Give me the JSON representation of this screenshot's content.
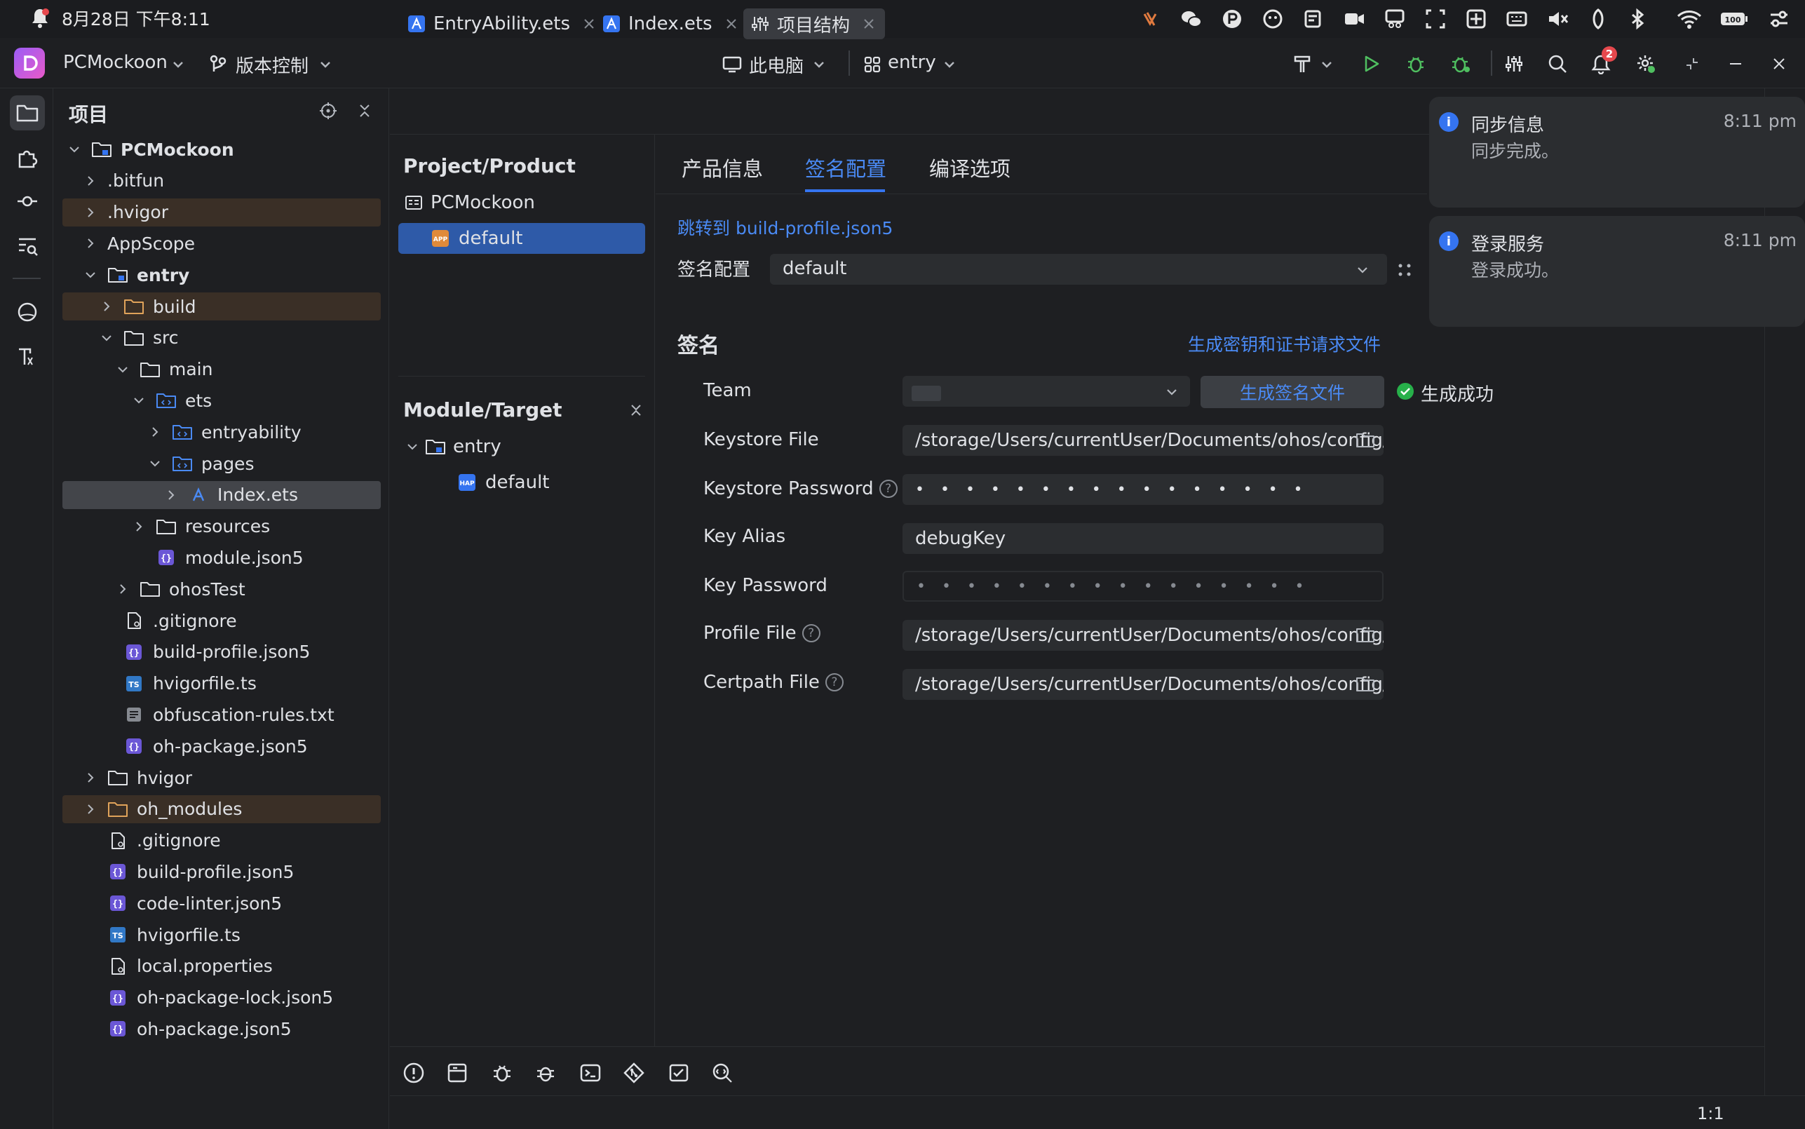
{
  "system_bar": {
    "datetime": "8月28日 下午8:11"
  },
  "title_bar": {
    "project_name": "PCMockoon",
    "vcs_label": "版本控制",
    "device_label": "此电脑",
    "module_label": "entry",
    "notification_count": "2"
  },
  "project_panel": {
    "title": "项目",
    "tree": [
      {
        "label": "PCMockoon",
        "depth": 0,
        "expanded": true,
        "icon": "project-folder",
        "bold": true
      },
      {
        "label": ".bitfun",
        "depth": 1,
        "icon": "none"
      },
      {
        "label": ".hvigor",
        "depth": 1,
        "icon": "none",
        "highlight": true
      },
      {
        "label": "AppScope",
        "depth": 1,
        "icon": "none"
      },
      {
        "label": "entry",
        "depth": 1,
        "expanded": true,
        "icon": "module-folder",
        "bold": true
      },
      {
        "label": "build",
        "depth": 2,
        "icon": "orange-folder",
        "highlight": true
      },
      {
        "label": "src",
        "depth": 2,
        "expanded": true,
        "icon": "folder"
      },
      {
        "label": "main",
        "depth": 3,
        "expanded": true,
        "icon": "folder"
      },
      {
        "label": "ets",
        "depth": 4,
        "expanded": true,
        "icon": "source-folder"
      },
      {
        "label": "entryability",
        "depth": 5,
        "icon": "source-folder"
      },
      {
        "label": "pages",
        "depth": 5,
        "expanded": true,
        "icon": "source-folder"
      },
      {
        "label": "Index.ets",
        "depth": 6,
        "icon": "ets-file",
        "selected": true
      },
      {
        "label": "resources",
        "depth": 4,
        "icon": "folder"
      },
      {
        "label": "module.json5",
        "depth": 4,
        "icon": "json-file",
        "leaf": true
      },
      {
        "label": "ohosTest",
        "depth": 3,
        "icon": "folder"
      },
      {
        "label": ".gitignore",
        "depth": 2,
        "icon": "text-file",
        "leaf": true
      },
      {
        "label": "build-profile.json5",
        "depth": 2,
        "icon": "json-file",
        "leaf": true
      },
      {
        "label": "hvigorfile.ts",
        "depth": 2,
        "icon": "ts-file",
        "leaf": true
      },
      {
        "label": "obfuscation-rules.txt",
        "depth": 2,
        "icon": "lines-file",
        "leaf": true
      },
      {
        "label": "oh-package.json5",
        "depth": 2,
        "icon": "json-file",
        "leaf": true
      },
      {
        "label": "hvigor",
        "depth": 1,
        "icon": "folder"
      },
      {
        "label": "oh_modules",
        "depth": 1,
        "icon": "orange-folder",
        "highlight": true
      },
      {
        "label": ".gitignore",
        "depth": 1,
        "icon": "text-file",
        "leaf": true
      },
      {
        "label": "build-profile.json5",
        "depth": 1,
        "icon": "json-file",
        "leaf": true
      },
      {
        "label": "code-linter.json5",
        "depth": 1,
        "icon": "json-file",
        "leaf": true
      },
      {
        "label": "hvigorfile.ts",
        "depth": 1,
        "icon": "ts-file",
        "leaf": true
      },
      {
        "label": "local.properties",
        "depth": 1,
        "icon": "text-file",
        "leaf": true
      },
      {
        "label": "oh-package-lock.json5",
        "depth": 1,
        "icon": "json-file",
        "leaf": true
      },
      {
        "label": "oh-package.json5",
        "depth": 1,
        "icon": "json-file",
        "leaf": true
      }
    ]
  },
  "editor_tabs": [
    {
      "label": "EntryAbility.ets",
      "icon": "ets-file"
    },
    {
      "label": "Index.ets",
      "icon": "ets-file"
    },
    {
      "label": "项目结构",
      "icon": "structure-icon",
      "active": true
    }
  ],
  "project_structure": {
    "product_heading": "Project/Product",
    "product_root": "PCMockoon",
    "product_item": "default",
    "module_heading": "Module/Target",
    "module_root": "entry",
    "module_item": "default"
  },
  "signing": {
    "tabs": [
      "产品信息",
      "签名配置",
      "编译选项"
    ],
    "active_tab": "签名配置",
    "jump_link": "跳转到 build-profile.json5",
    "config_label": "签名配置",
    "config_value": "default",
    "section_title": "签名",
    "generate_key_link": "生成密钥和证书请求文件",
    "team_label": "Team",
    "generate_button": "生成签名文件",
    "success_text": "生成成功",
    "keystore_file_label": "Keystore File",
    "keystore_file_value": "/storage/Users/currentUser/Documents/ohos/config/c",
    "keystore_password_label": "Keystore Password",
    "keystore_password_value": "• • • • • • • • • • • • • • • •",
    "key_alias_label": "Key Alias",
    "key_alias_value": "debugKey",
    "key_password_label": "Key Password",
    "key_password_value": "• • • • • • • • • • • • • • • •",
    "profile_file_label": "Profile File",
    "profile_file_value": "/storage/Users/currentUser/Documents/ohos/config/c",
    "certpath_file_label": "Certpath File",
    "certpath_file_value": "/storage/Users/currentUser/Documents/ohos/config/c",
    "help_glyph": "?"
  },
  "notifications": [
    {
      "title": "同步信息",
      "body": "同步完成。",
      "time": "8:11 pm",
      "glyph": "i"
    },
    {
      "title": "登录服务",
      "body": "登录成功。",
      "time": "8:11 pm",
      "glyph": "i"
    }
  ],
  "status_bar": {
    "position": "1:1"
  },
  "colors": {
    "accent": "#3574f0",
    "link": "#4a8af4",
    "success": "#27b04a",
    "highlight_row": "#3a2f26"
  }
}
